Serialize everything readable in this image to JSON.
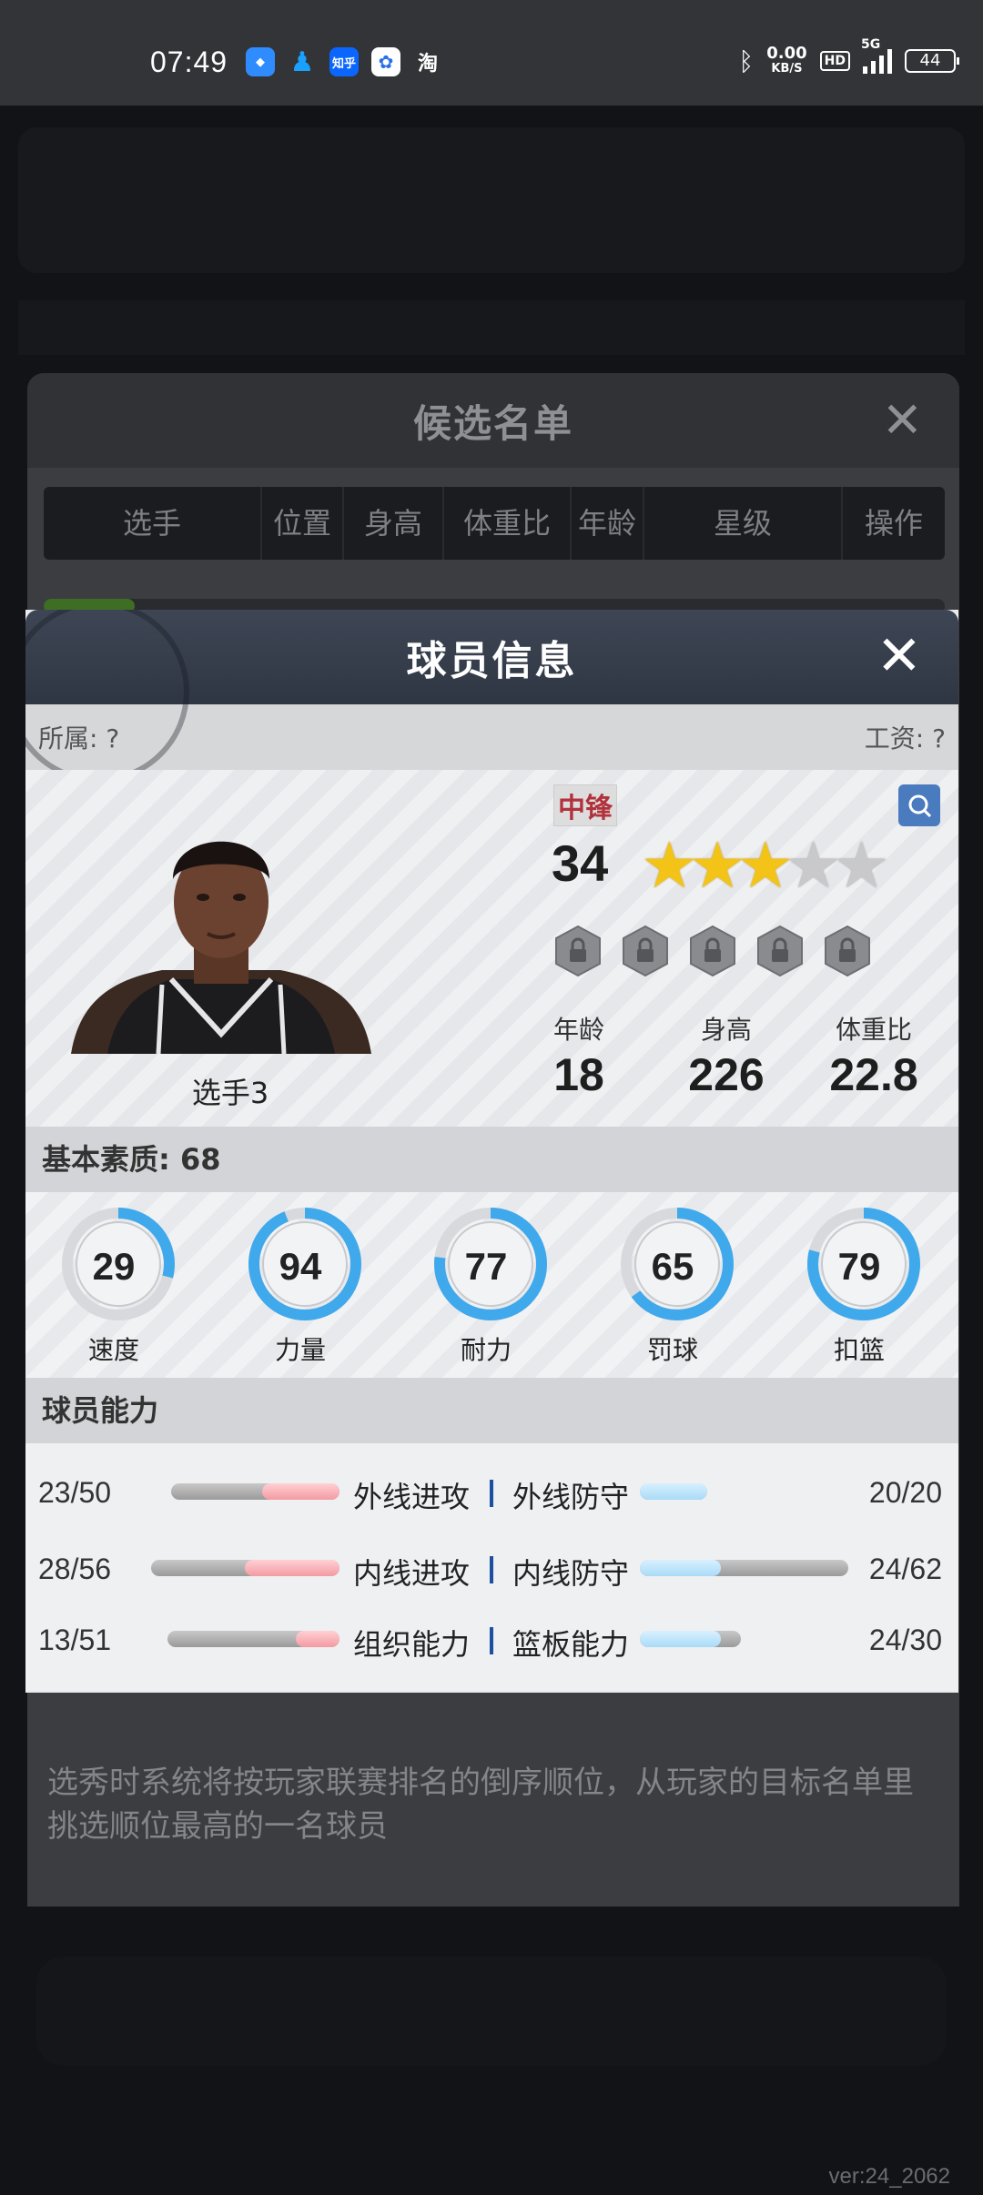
{
  "status_bar": {
    "time": "07:49",
    "apps": [
      {
        "icon": "browser-icon",
        "label": "",
        "color": "#2f8cff"
      },
      {
        "icon": "qq-icon",
        "label": "",
        "color": "#1aa0ff"
      },
      {
        "icon": "zhihu-icon",
        "label": "知乎",
        "color": "#0a66ff"
      },
      {
        "icon": "baidu-icon",
        "label": "",
        "color": "#2b6fe8"
      },
      {
        "icon": "taobao-icon",
        "label": "淘",
        "color": "#333437"
      }
    ],
    "net_speed_value": "0.00",
    "net_speed_unit": "KB/S",
    "hd_label": "HD",
    "network": "5G",
    "battery": "44"
  },
  "candidate_list": {
    "title": "候选名单",
    "columns": [
      "选手",
      "位置",
      "身高",
      "体重比",
      "年龄",
      "星级",
      "操作"
    ],
    "note": "选秀时系统将按玩家联赛排名的倒序顺位，从玩家的目标名单里挑选顺位最高的一名球员"
  },
  "player_modal": {
    "title": "球员信息",
    "affiliation": "所属: ?",
    "salary": "工资: ?",
    "name": "选手3",
    "position": "中锋",
    "overall": "34",
    "stars": 3,
    "max_stars": 5,
    "age_label": "年龄",
    "age": "18",
    "height_label": "身高",
    "height": "226",
    "weight_ratio_label": "体重比",
    "weight_ratio": "22.8",
    "basic_quality_label": "基本素质: 68",
    "basic_stats": [
      {
        "label": "速度",
        "value": 29
      },
      {
        "label": "力量",
        "value": 94
      },
      {
        "label": "耐力",
        "value": 77
      },
      {
        "label": "罚球",
        "value": 65
      },
      {
        "label": "扣篮",
        "value": 79
      }
    ],
    "abilities_label": "球员能力",
    "abilities": [
      {
        "left_value": "23/50",
        "left_name": "外线进攻",
        "right_name": "外线防守",
        "right_value": "20/20"
      },
      {
        "left_value": "28/56",
        "left_name": "内线进攻",
        "right_name": "内线防守",
        "right_value": "24/62"
      },
      {
        "left_value": "13/51",
        "left_name": "组织能力",
        "right_name": "篮板能力",
        "right_value": "24/30"
      }
    ]
  },
  "version": "ver:24_2062"
}
